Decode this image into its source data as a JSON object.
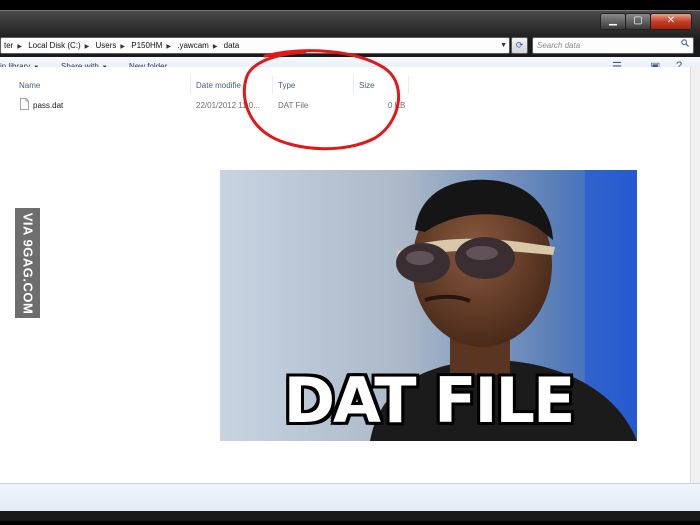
{
  "window": {
    "minimize": "▁",
    "maximize": "▢",
    "close": "✕"
  },
  "address": {
    "crumbs": [
      "ter",
      "Local Disk (C:)",
      "Users",
      "P150HM",
      ".yawcam",
      "data"
    ],
    "search_placeholder": "Search data"
  },
  "toolbar": {
    "include_in_library": "in library",
    "share_with": "Share with",
    "new_folder": "New folder"
  },
  "columns": {
    "name": "Name",
    "date_modified": "Date modifie",
    "type": "Type",
    "size": "Size"
  },
  "files": [
    {
      "name": "pass.dat",
      "date": "22/01/2012 11:0...",
      "type": "DAT File",
      "size": "0 KB"
    }
  ],
  "overlay": {
    "watermark": "VIA 9GAG.COM",
    "meme_caption": "DAT FILE"
  },
  "colors": {
    "annotation_circle": "#e01818",
    "titlebar": "#1a1a1a",
    "close_button": "#c2402a"
  }
}
